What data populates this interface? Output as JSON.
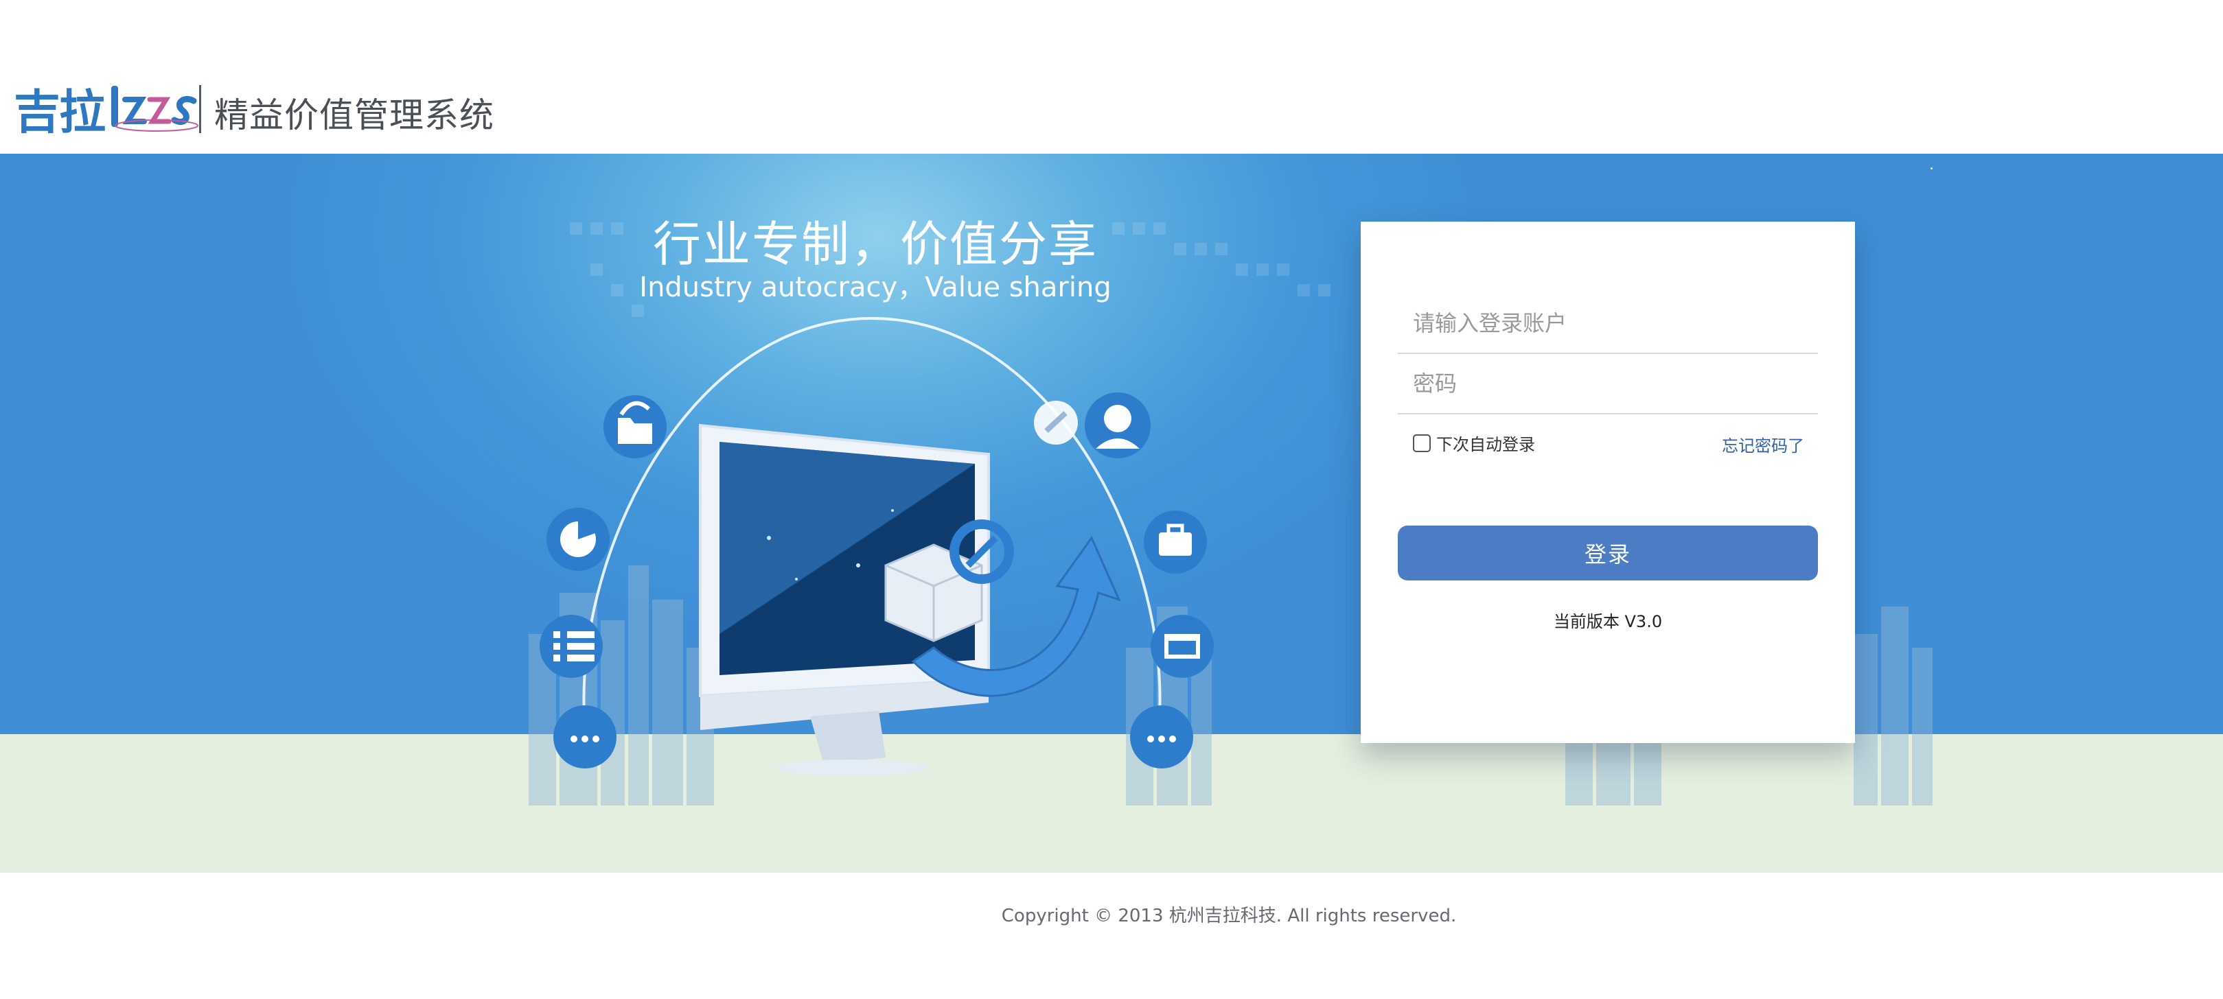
{
  "header": {
    "logo_text": "吉拉",
    "logo_mark": "lzzs",
    "system_title": "精益价值管理系统"
  },
  "banner": {
    "slogan_cn": "行业专制，价值分享",
    "slogan_en": "Industry autocracy，Value sharing",
    "icons": [
      "folder-icon",
      "pie-chart-icon",
      "numbered-list-icon",
      "more-icon",
      "user-avatar-icon",
      "briefcase-icon",
      "window-icon",
      "more-icon",
      "link-icon"
    ]
  },
  "login": {
    "username_placeholder": "请输入登录账户",
    "password_placeholder": "密码",
    "remember_label": "下次自动登录",
    "remember_checked": false,
    "forgot_label": "忘记密码了",
    "submit_label": "登录",
    "version_text": "当前版本 V3.0"
  },
  "footer": {
    "copyright": "Copyright © 2013 杭州吉拉科技. All rights reserved."
  },
  "colors": {
    "brand_blue": "#2e78c2",
    "banner_blue": "#3f8ed6",
    "button_blue": "#4c7dc4",
    "link_blue": "#2f5fa8",
    "floor_green": "#e4efdf"
  }
}
